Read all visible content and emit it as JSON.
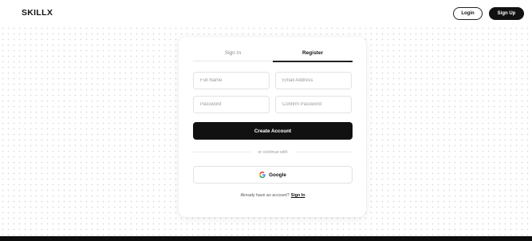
{
  "header": {
    "logo": "SKILLX",
    "login_label": "Login",
    "signup_label": "Sign Up"
  },
  "auth": {
    "tabs": {
      "signin": "Sign In",
      "register": "Register",
      "active": "register"
    },
    "fields": {
      "full_name_placeholder": "Full Name",
      "email_placeholder": "Email Address",
      "password_placeholder": "Password",
      "confirm_password_placeholder": "Confirm Password"
    },
    "create_button": "Create Account",
    "divider_text": "or continue with",
    "google_button": "Google",
    "google_icon": "google-g-icon",
    "footer_text": "Already have an account?",
    "footer_link": "Sign In"
  },
  "colors": {
    "primary": "#111111",
    "background": "#ffffff",
    "dot_grid": "#d6d6d6"
  }
}
